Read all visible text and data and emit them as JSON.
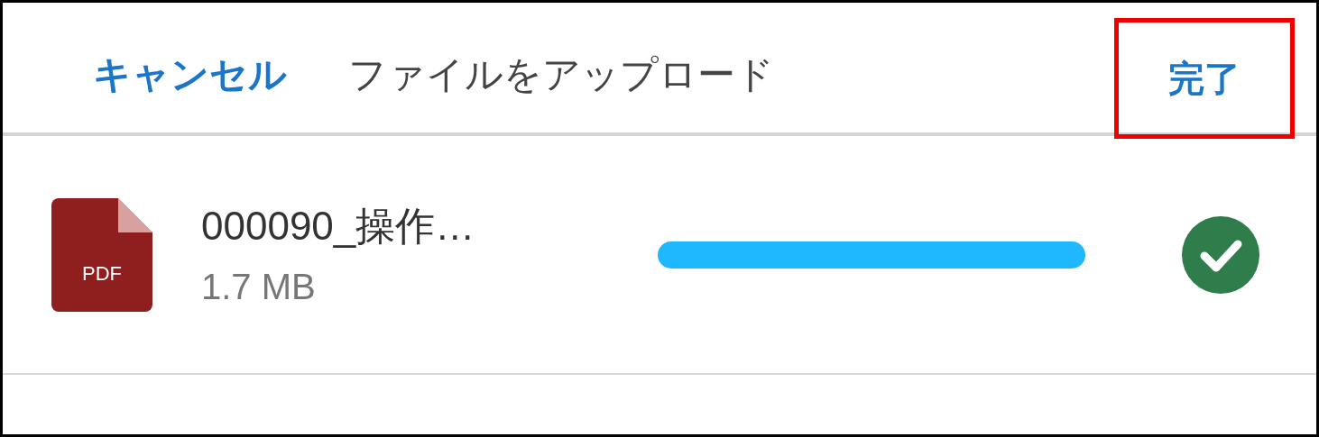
{
  "header": {
    "cancel": "キャンセル",
    "title": "ファイルをアップロード",
    "done": {
      "label": "完了",
      "highlighted": true
    }
  },
  "files": [
    {
      "kind": "pdf",
      "icon_label": "PDF",
      "name": "000090_操作…",
      "size": "1.7 MB",
      "level": 1,
      "complete": true
    }
  ]
}
